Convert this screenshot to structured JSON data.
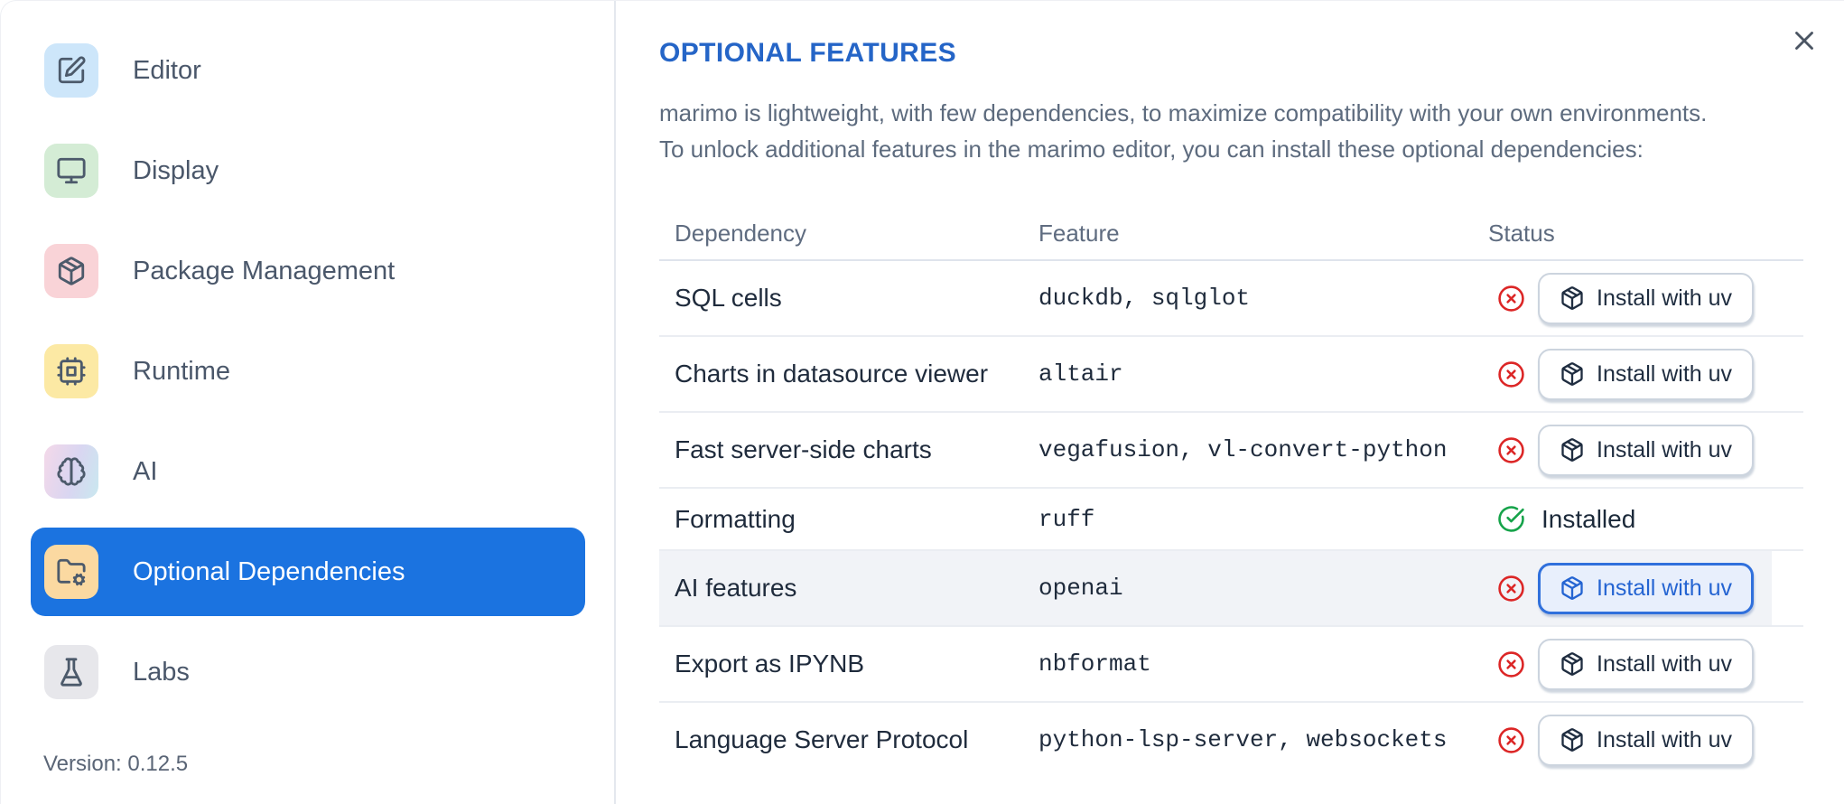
{
  "sidebar": {
    "items": [
      {
        "label": "Editor",
        "icon": "square-pen",
        "slug": "editor",
        "tile_color": "#cde6fa",
        "selected": false
      },
      {
        "label": "Display",
        "icon": "monitor",
        "slug": "display",
        "tile_color": "#d4ecd5",
        "selected": false
      },
      {
        "label": "Package Management",
        "icon": "package",
        "slug": "package-management",
        "tile_color": "#f9d3d7",
        "selected": false
      },
      {
        "label": "Runtime",
        "icon": "cpu",
        "slug": "runtime",
        "tile_color": "#fce9a4",
        "selected": false
      },
      {
        "label": "AI",
        "icon": "brain",
        "slug": "ai",
        "tile_color": "linear-gradient(105deg,#f4d8e9 0%,#d9d6f1 55%,#c9e8ef 100%)",
        "selected": false
      },
      {
        "label": "Optional Dependencies",
        "icon": "folder-cog",
        "slug": "optional-dependencies",
        "tile_color": "#fbd9a1",
        "selected": true
      },
      {
        "label": "Labs",
        "icon": "flask-conical",
        "slug": "labs",
        "tile_color": "#e7e7eb",
        "selected": false
      }
    ],
    "version_label": "Version: 0.12.5"
  },
  "main": {
    "title": "OPTIONAL FEATURES",
    "description": [
      "marimo is lightweight, with few dependencies, to maximize compatibility with your own environments.",
      "To unlock additional features in the marimo editor, you can install these optional dependencies:"
    ],
    "table": {
      "headers": [
        "Dependency",
        "Feature",
        "Status"
      ],
      "rows": [
        {
          "dependency": "SQL cells",
          "feature": "duckdb, sqlglot",
          "status": "not-installed",
          "action": "Install with uv",
          "highlighted": false,
          "button_focused": false
        },
        {
          "dependency": "Charts in datasource viewer",
          "feature": "altair",
          "status": "not-installed",
          "action": "Install with uv",
          "highlighted": false,
          "button_focused": false
        },
        {
          "dependency": "Fast server-side charts",
          "feature": "vegafusion, vl-convert-python",
          "status": "not-installed",
          "action": "Install with uv",
          "highlighted": false,
          "button_focused": false
        },
        {
          "dependency": "Formatting",
          "feature": "ruff",
          "status": "installed",
          "status_label": "Installed",
          "highlighted": false,
          "button_focused": false
        },
        {
          "dependency": "AI features",
          "feature": "openai",
          "status": "not-installed",
          "action": "Install with uv",
          "highlighted": true,
          "button_focused": true
        },
        {
          "dependency": "Export as IPYNB",
          "feature": "nbformat",
          "status": "not-installed",
          "action": "Install with uv",
          "highlighted": false,
          "button_focused": false
        },
        {
          "dependency": "Language Server Protocol",
          "feature": "python-lsp-server, websockets",
          "status": "not-installed",
          "action": "Install with uv",
          "highlighted": false,
          "button_focused": false
        }
      ]
    }
  },
  "colors": {
    "accent_blue": "#2565c7",
    "selected_item_blue": "#1b73e0",
    "error_red": "#dc2626",
    "success_green": "#16a34a",
    "row_highlight": "#f1f3f7"
  }
}
